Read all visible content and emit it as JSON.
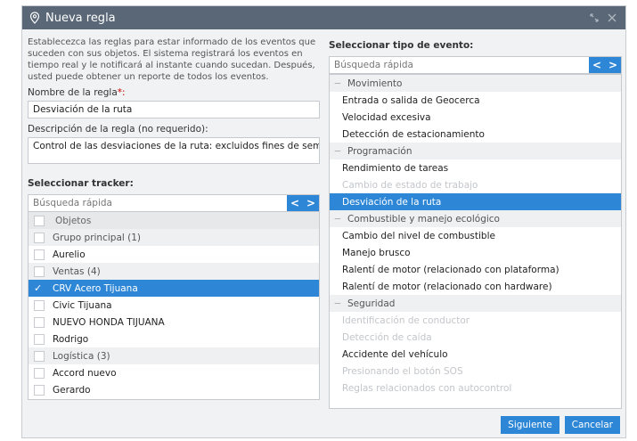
{
  "window": {
    "title": "Nueva regla"
  },
  "left": {
    "intro": "Establecezca las reglas para estar informado de los eventos que suceden con sus objetos. El sistema registrará los eventos en tiempo real y le notificará al instante cuando sucedan. Después, usted puede obtener un reporte de todos los eventos.",
    "name_label": "Nombre de la regla",
    "name_required": "*:",
    "name_value": "Desviación de la ruta",
    "desc_label": "Descripción de la regla (no requerido):",
    "desc_value": "Control de las desviaciones de la ruta: excluidos fines de semana",
    "tracker_title": "Seleccionar tracker:",
    "search_placeholder": "Búsqueda rápida",
    "objects_header": "Objetos",
    "groups": [
      {
        "label": "Grupo principal (1)",
        "items": [
          "Aurelio"
        ]
      },
      {
        "label": "Ventas (4)",
        "items": [
          "CRV Acero Tijuana",
          "Civic Tijuana",
          "NUEVO HONDA TIJUANA",
          "Rodrigo"
        ]
      },
      {
        "label": "Logística (3)",
        "items": [
          "Accord nuevo",
          "Gerardo"
        ]
      }
    ]
  },
  "right": {
    "title": "Seleccionar tipo de evento:",
    "search_placeholder": "Búsqueda rápida",
    "categories": [
      {
        "label": "Movimiento",
        "items": [
          "Entrada o salida de Geocerca",
          "Velocidad excesiva",
          "Detección de estacionamiento"
        ]
      },
      {
        "label": "Programación",
        "items": [
          "Rendimiento de tareas",
          "Cambio de estado de trabajo",
          "Desviación de la ruta"
        ]
      },
      {
        "label": "Combustible y manejo ecológico",
        "items": [
          "Cambio del nivel de combustible",
          "Manejo brusco",
          "Ralentí de motor (relacionado con plataforma)",
          "Ralentí de motor (relacionado con hardware)"
        ]
      },
      {
        "label": "Seguridad",
        "items": [
          "Identificación de conductor",
          "Detección de caída",
          "Accidente del vehículo",
          "Presionando el botón SOS",
          "Reglas relacionados con autocontrol"
        ]
      }
    ]
  },
  "buttons": {
    "next": "Siguiente",
    "cancel": "Cancelar"
  },
  "arrows": {
    "prev": "<",
    "next": ">"
  },
  "colors": {
    "titlebar": "#596777",
    "accent": "#2d86d6"
  }
}
